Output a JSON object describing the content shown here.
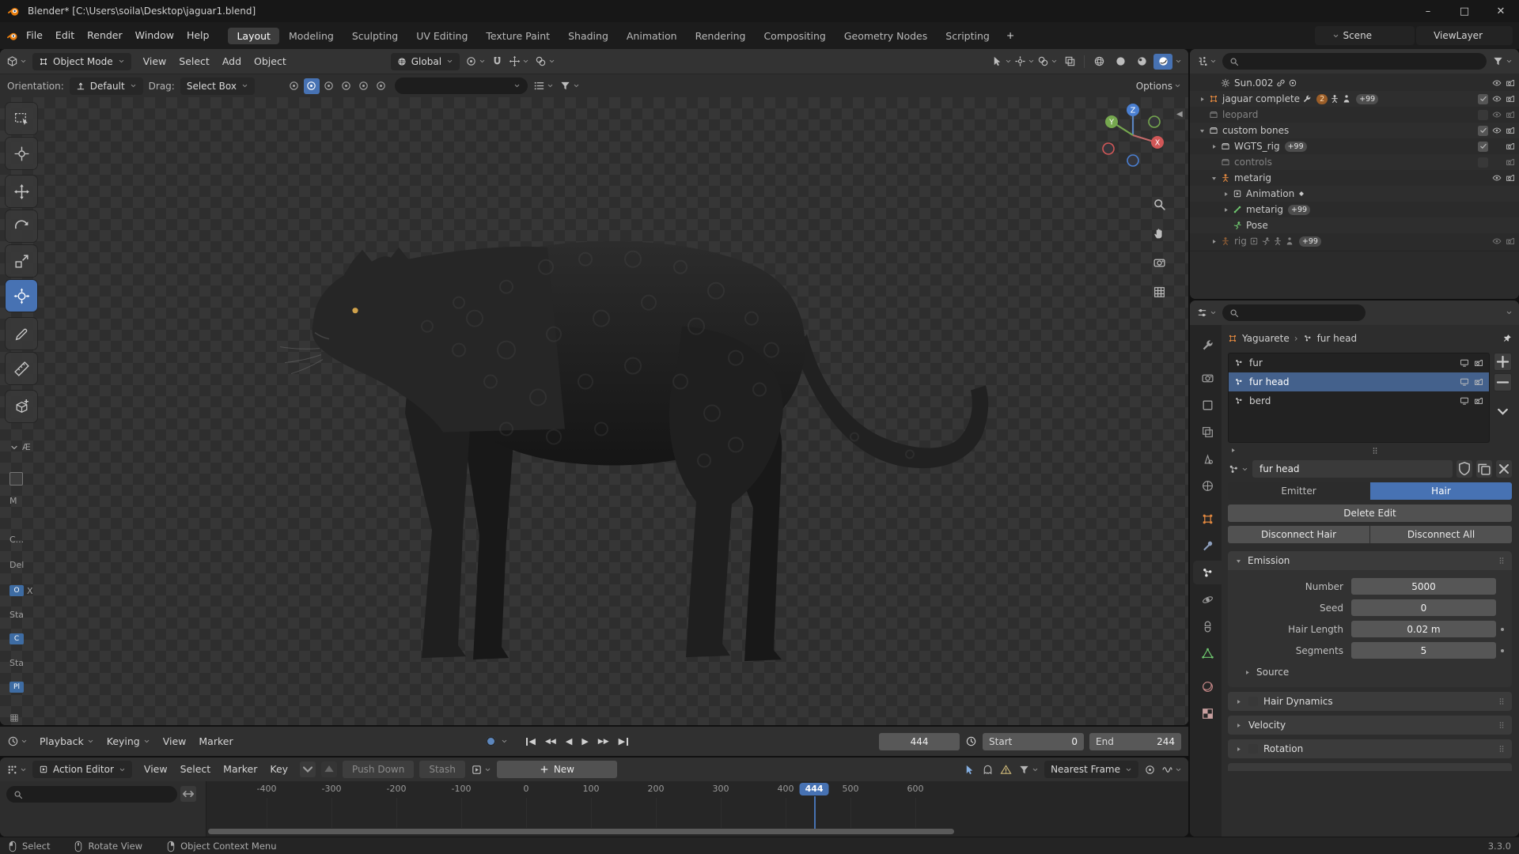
{
  "window": {
    "title": "Blender* [C:\\Users\\soila\\Desktop\\jaguar1.blend]"
  },
  "topbar": {
    "menus": [
      "File",
      "Edit",
      "Render",
      "Window",
      "Help"
    ],
    "workspaces": [
      "Layout",
      "Modeling",
      "Sculpting",
      "UV Editing",
      "Texture Paint",
      "Shading",
      "Animation",
      "Rendering",
      "Compositing",
      "Geometry Nodes",
      "Scripting"
    ],
    "active_workspace": "Layout",
    "add_workspace_label": "+",
    "scene_label": "Scene",
    "view_layer_label": "ViewLayer"
  },
  "viewport": {
    "mode": "Object Mode",
    "menus": [
      "View",
      "Select",
      "Add",
      "Object"
    ],
    "orientation": "Global",
    "header_right_icons": [
      "object-visibility",
      "gizmo",
      "overlays",
      "xray",
      "shading-wireframe",
      "shading-solid",
      "shading-material",
      "shading-rendered"
    ],
    "active_shading": "shading-rendered",
    "tool_row": {
      "orientation_label": "Orientation:",
      "orientation_value": "Default",
      "drag_label": "Drag:",
      "drag_value": "Select Box",
      "options_label": "Options",
      "mini_toggles": [
        "origin",
        "snap-increment",
        "snap-vertex",
        "snap-edge",
        "snap-face",
        "snap-volume"
      ],
      "active_mini_toggle": "snap-increment"
    },
    "tools": [
      {
        "name": "select-box"
      },
      {
        "name": "cursor"
      },
      {
        "name": "move"
      },
      {
        "name": "rotate"
      },
      {
        "name": "scale"
      },
      {
        "name": "transform",
        "active": true
      },
      {
        "name": "annotate"
      },
      {
        "name": "measure"
      },
      {
        "name": "add-cube"
      }
    ],
    "overlay_items": [
      {
        "icon": "chevron-down",
        "text": "Æ"
      },
      {
        "icon": "box"
      },
      {
        "text": "M"
      },
      {
        "text": "C..."
      },
      {
        "text": "Del"
      },
      {
        "chip": "O",
        "text": "X"
      },
      {
        "text": "Sta"
      },
      {
        "chip": "C"
      },
      {
        "text": "Sta"
      },
      {
        "chip": "Pl"
      },
      {
        "icon": "grid"
      }
    ],
    "axis_labels": {
      "x": "X",
      "y": "Y",
      "z": "Z"
    }
  },
  "outliner": {
    "rows": [
      {
        "label": "Sun.002",
        "icon": "light",
        "indent": 1,
        "expand": null,
        "dim": false,
        "inline": [
          {
            "icon": "link"
          },
          {
            "icon": "circle-dot"
          }
        ],
        "check": null,
        "eye": true,
        "cam": true
      },
      {
        "label": "jaguar complete",
        "icon": "object",
        "icon_color": "#e0873f",
        "indent": 0,
        "expand": "closed",
        "inline": [
          {
            "icon": "wrench"
          },
          {
            "badge": "2",
            "orange": true
          },
          {
            "icon": "armature"
          },
          {
            "icon": "person",
            "badge": "+99"
          }
        ],
        "check": "on",
        "eye": true,
        "cam": true
      },
      {
        "label": "leopard",
        "icon": "collection",
        "indent": 0,
        "expand": null,
        "dim": true,
        "check": "off",
        "eye": true,
        "cam": true
      },
      {
        "label": "custom bones",
        "icon": "collection",
        "indent": 0,
        "expand": "open",
        "check": "on",
        "eye": true,
        "cam": true
      },
      {
        "label": "WGTS_rig",
        "icon": "collection",
        "indent": 1,
        "expand": "closed",
        "inline": [
          {
            "badge": "+99"
          }
        ],
        "check": "on",
        "eye": null,
        "cam": true
      },
      {
        "label": "controls",
        "icon": "collection",
        "indent": 1,
        "expand": null,
        "dim": true,
        "check": "off",
        "eye": null,
        "cam": true
      },
      {
        "label": "metarig",
        "icon": "armature",
        "icon_color": "#e0873f",
        "indent": 1,
        "expand": "open",
        "check": null,
        "eye": true,
        "cam": true
      },
      {
        "label": "Animation",
        "icon": "action",
        "indent": 2,
        "expand": "closed",
        "inline": [
          {
            "icon": "keyframe"
          }
        ]
      },
      {
        "label": "metarig",
        "icon": "armature-data",
        "icon_color": "#6fc76f",
        "indent": 2,
        "expand": "closed",
        "inline": [
          {
            "badge": "+99"
          }
        ]
      },
      {
        "label": "Pose",
        "icon": "pose",
        "icon_color": "#6fc76f",
        "indent": 2,
        "expand": null
      },
      {
        "label": "rig",
        "icon": "armature",
        "icon_color": "#e0873f",
        "indent": 1,
        "expand": "closed",
        "dim": true,
        "inline": [
          {
            "icon": "action"
          },
          {
            "icon": "pose"
          },
          {
            "icon": "armature"
          },
          {
            "icon": "person",
            "badge": "+99"
          }
        ],
        "eye": true,
        "cam": true
      }
    ]
  },
  "properties": {
    "breadcrumb": {
      "object": "Yaguarete",
      "item": "fur head"
    },
    "tabs": [
      "tool",
      "render",
      "output",
      "view-layer",
      "scene",
      "world",
      "object",
      "modifiers",
      "particles",
      "physics",
      "constraints",
      "object-data",
      "material",
      "texture"
    ],
    "active_tab": "particles",
    "particles": {
      "slots": [
        {
          "name": "fur",
          "selected": false
        },
        {
          "name": "fur head",
          "selected": true
        },
        {
          "name": "berd",
          "selected": false
        }
      ],
      "name_value": "fur head",
      "type_options": [
        "Emitter",
        "Hair"
      ],
      "type_active": "Hair",
      "buttons": {
        "delete_edit": "Delete Edit",
        "disconnect_hair": "Disconnect Hair",
        "disconnect_all": "Disconnect All"
      },
      "emission": {
        "title": "Emission",
        "fields": [
          {
            "label": "Number",
            "value": "5000",
            "dot": false
          },
          {
            "label": "Seed",
            "value": "0",
            "dot": false
          },
          {
            "label": "Hair Length",
            "value": "0.02 m",
            "dot": true
          },
          {
            "label": "Segments",
            "value": "5",
            "dot": true
          }
        ],
        "sub": "Source"
      },
      "sections": [
        {
          "title": "Hair Dynamics",
          "checkbox": true
        },
        {
          "title": "Velocity",
          "checkbox": false
        },
        {
          "title": "Rotation",
          "checkbox": true
        }
      ]
    }
  },
  "timeline": {
    "menus": [
      "Playback",
      "Keying",
      "View",
      "Marker"
    ],
    "transport": [
      "jump-to-start",
      "jump-to-keyframe-prev",
      "play-reverse",
      "play",
      "jump-to-keyframe-next",
      "jump-to-end"
    ],
    "current_frame": "444",
    "start_label": "Start",
    "start_value": "0",
    "end_label": "End",
    "end_value": "244"
  },
  "dopesheet": {
    "editor_mode": "Action Editor",
    "menus": [
      "View",
      "Select",
      "Marker",
      "Key"
    ],
    "push_down_label": "Push Down",
    "stash_label": "Stash",
    "new_label": "New",
    "snap_value": "Nearest Frame",
    "right_icons": [
      "only-selected",
      "ghost",
      "warning",
      "filter",
      "proportional",
      "interpolation"
    ],
    "ruler_frames": [
      -400,
      -300,
      -200,
      -100,
      0,
      100,
      200,
      300,
      400,
      500,
      600
    ],
    "playhead_frame": 444,
    "playhead_label": "444"
  },
  "statusbar": {
    "hints": [
      {
        "icon": "mouse-left",
        "label": "Select"
      },
      {
        "icon": "mouse-middle",
        "label": "Rotate View"
      },
      {
        "icon": "mouse-right",
        "label": "Object Context Menu"
      }
    ],
    "version": "3.3.0"
  },
  "colors": {
    "accent": "#4772b3",
    "selected_row": "#44618c",
    "axis_x": "#d15757",
    "axis_y": "#76a84f",
    "axis_z": "#4a7fd1"
  }
}
